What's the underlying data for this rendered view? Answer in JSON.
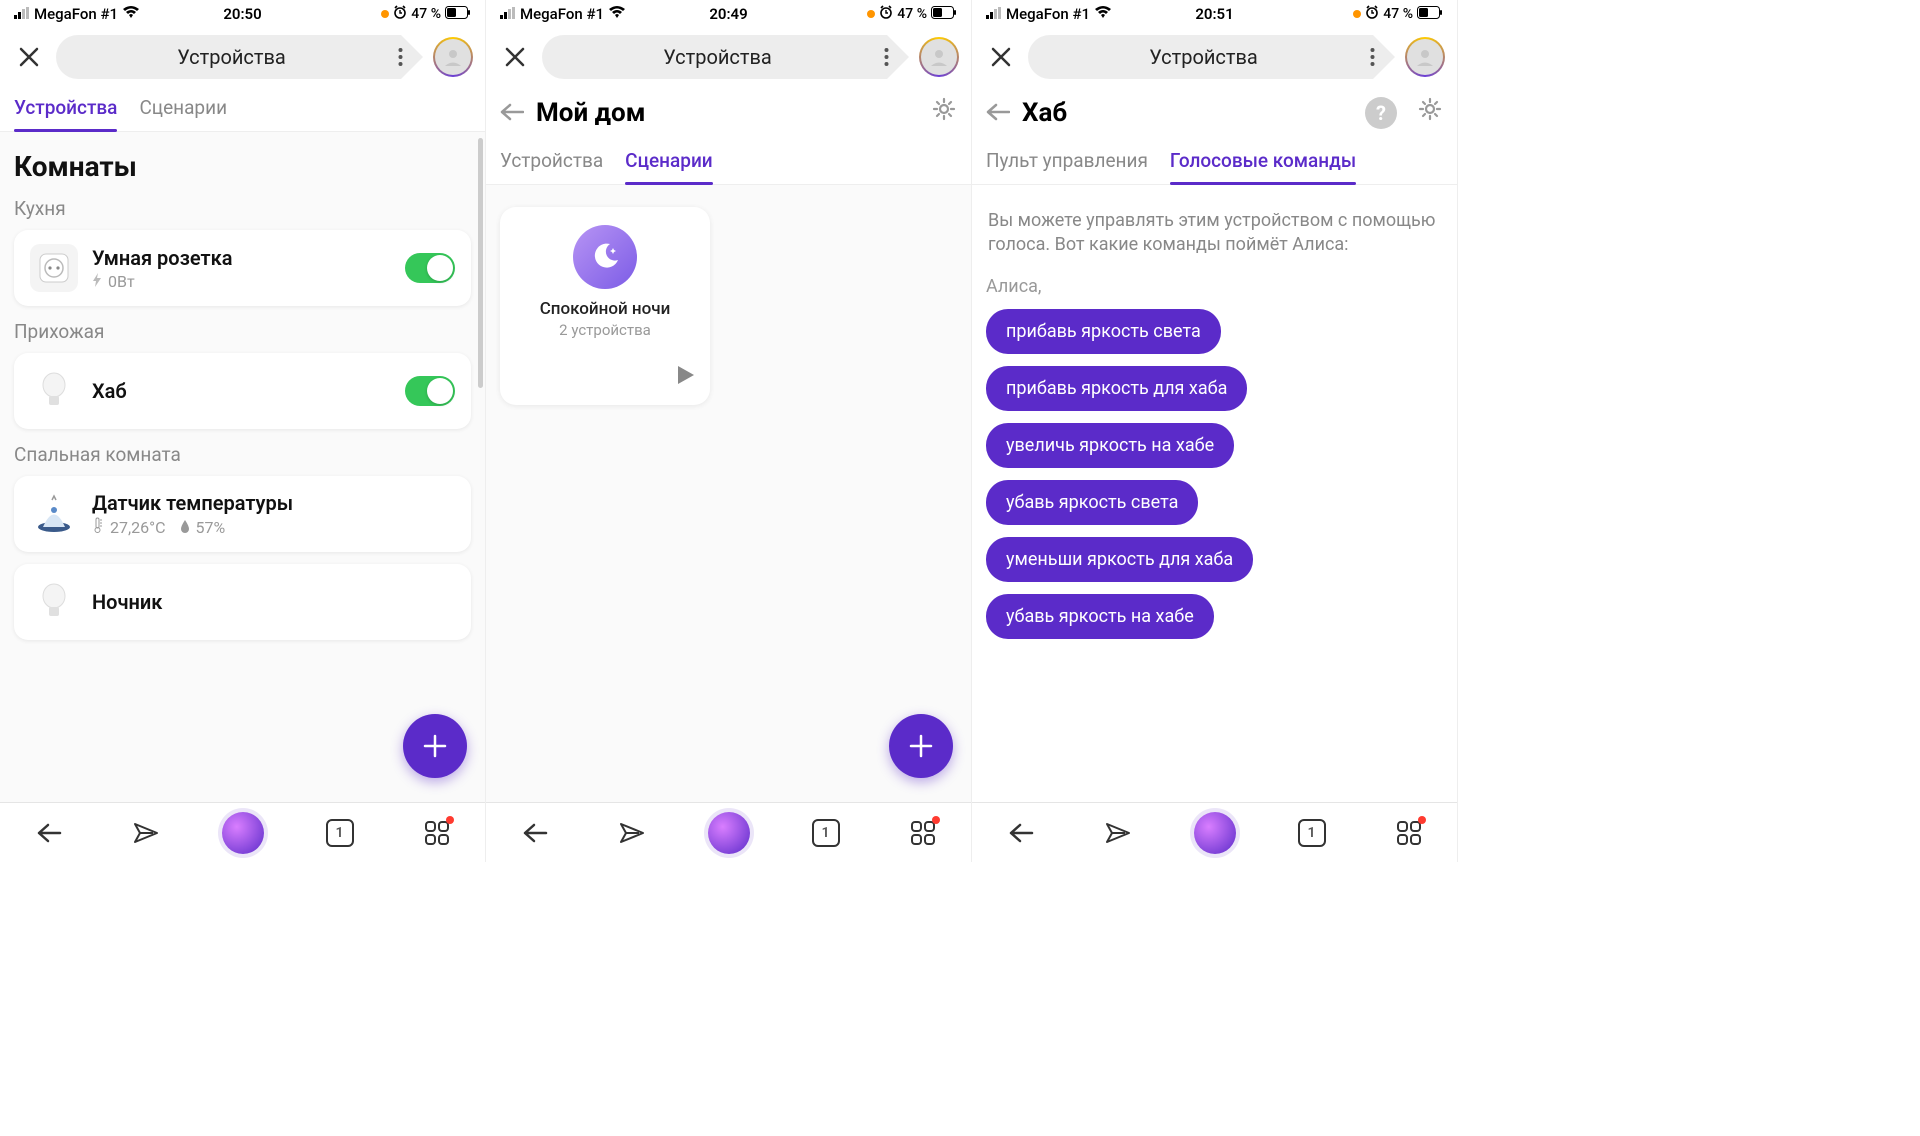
{
  "status": {
    "carrier": "MegaFon #1",
    "times": [
      "20:50",
      "20:49",
      "20:51"
    ],
    "battery": "47 %"
  },
  "header": {
    "title": "Устройства"
  },
  "screen1": {
    "tabs": [
      "Устройства",
      "Сценарии"
    ],
    "section": "Комнаты",
    "rooms": [
      {
        "name": "Кухня",
        "devices": [
          {
            "name": "Умная розетка",
            "sub": "0Вт",
            "toggle": true,
            "icon": "socket"
          }
        ]
      },
      {
        "name": "Прихожая",
        "devices": [
          {
            "name": "Хаб",
            "toggle": true,
            "icon": "bulb"
          }
        ]
      },
      {
        "name": "Спальная комната",
        "devices": [
          {
            "name": "Датчик температуры",
            "temp": "27,26°C",
            "humidity": "57%",
            "icon": "sensor"
          },
          {
            "name": "Ночник",
            "icon": "bulb"
          }
        ]
      }
    ]
  },
  "screen2": {
    "back_title": "Мой дом",
    "tabs": [
      "Устройства",
      "Сценарии"
    ],
    "scenario": {
      "name": "Спокойной ночи",
      "sub": "2 устройства"
    }
  },
  "screen3": {
    "back_title": "Хаб",
    "tabs": [
      "Пульт управления",
      "Голосовые команды"
    ],
    "intro": "Вы можете управлять этим устройством с помощью голоса. Вот какие команды поймёт Алиса:",
    "alice": "Алиса,",
    "commands": [
      "прибавь яркость света",
      "прибавь яркость для хаба",
      "увеличь яркость на хабе",
      "убавь яркость света",
      "уменьши яркость для хаба",
      "убавь яркость на хабе"
    ]
  },
  "nav": {
    "count": "1"
  }
}
